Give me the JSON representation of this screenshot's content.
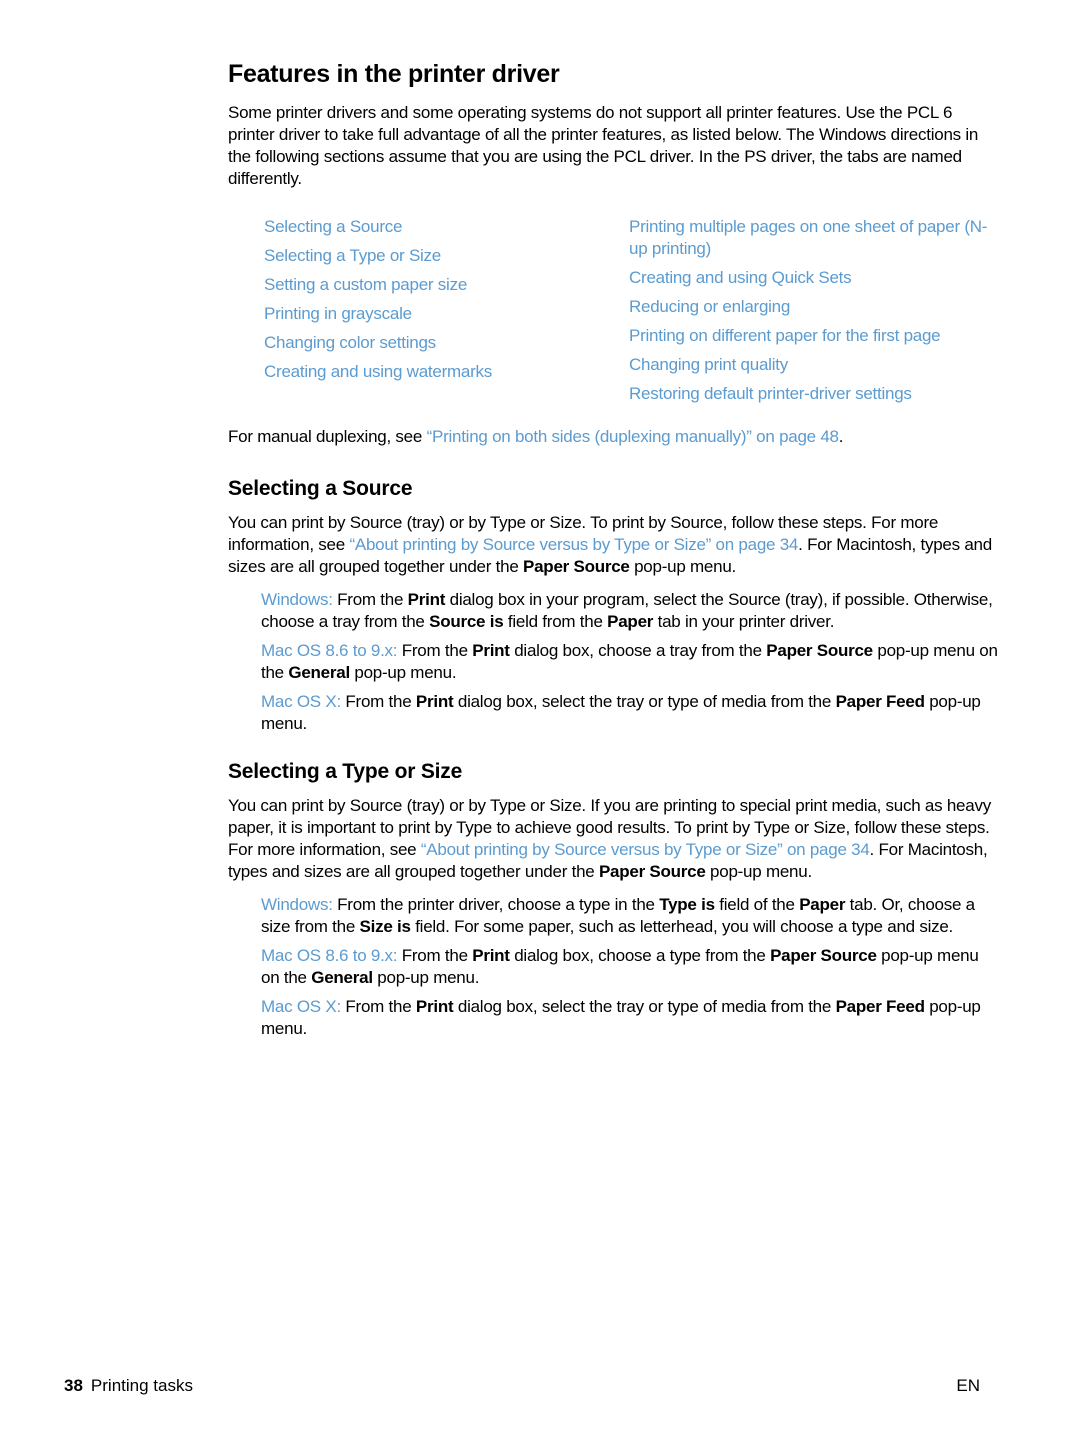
{
  "title": "Features in the printer driver",
  "intro": "Some printer drivers and some operating systems do not support all printer features. Use the PCL 6 printer driver to take full advantage of all the printer features, as listed below. The Windows directions in the following sections assume that you are using the PCL driver. In the PS driver, the tabs are named differently.",
  "toc": {
    "left": [
      "Selecting a Source",
      "Selecting a Type or Size",
      "Setting a custom paper size",
      "Printing in grayscale",
      "Changing color settings",
      "Creating and using watermarks"
    ],
    "right": [
      "Printing multiple pages on one sheet of paper (N-up printing)",
      "Creating and using Quick Sets",
      "Reducing or enlarging",
      "Printing on different paper for the first page",
      "Changing print quality",
      "Restoring default printer-driver settings"
    ]
  },
  "duplex": {
    "prefix": "For manual duplexing, see ",
    "link": "“Printing on both sides (duplexing manually)” on page 48",
    "suffix": "."
  },
  "section_source": {
    "heading": "Selecting a Source",
    "body_1": "You can print by Source (tray) or by Type or Size. To print by Source, follow these steps. For more information, see ",
    "body_link": "“About printing by Source versus by Type or Size” on page 34",
    "body_2": ". For Macintosh, types and sizes are all grouped together under the ",
    "body_bold": "Paper Source",
    "body_3": " pop-up menu.",
    "steps": {
      "windows": {
        "os": "Windows:",
        "t1": " From the ",
        "b1": "Print",
        "t2": " dialog box in your program, select the Source (tray), if possible. Otherwise, choose a tray from the ",
        "b2": "Source is",
        "t3": " field from the ",
        "b3": "Paper",
        "t4": " tab in your printer driver."
      },
      "mac9": {
        "os": "Mac OS 8.6 to 9.x:",
        "t1": " From the ",
        "b1": "Print",
        "t2": " dialog box, choose a tray from the ",
        "b2": "Paper Source",
        "t3": " pop-up menu on the ",
        "b3": "General",
        "t4": " pop-up menu."
      },
      "macx": {
        "os": "Mac OS X:",
        "t1": " From the ",
        "b1": "Print",
        "t2": " dialog box, select the tray or type of media from the ",
        "b2": "Paper Feed",
        "t3": " pop-up menu."
      }
    }
  },
  "section_type": {
    "heading": "Selecting a Type or Size",
    "body_1": "You can print by Source (tray) or by Type or Size. If you are printing to special print media, such as heavy paper, it is important to print by Type to achieve good results. To print by Type or Size, follow these steps. For more information, see ",
    "body_link": "“About printing by Source versus by Type or Size” on page 34",
    "body_2": ". For Macintosh, types and sizes are all grouped together under the ",
    "body_bold": "Paper Source",
    "body_3": " pop-up menu.",
    "steps": {
      "windows": {
        "os": "Windows:",
        "t1": " From the printer driver, choose a type in the ",
        "b1": "Type is",
        "t2": " field of the ",
        "b2": "Paper",
        "t3": " tab. Or, choose a size from the ",
        "b3": "Size is",
        "t4": " field. For some paper, such as letterhead, you will choose a type and size."
      },
      "mac9": {
        "os": "Mac OS 8.6 to 9.x:",
        "t1": " From the ",
        "b1": "Print",
        "t2": " dialog box, choose a type from the ",
        "b2": "Paper Source",
        "t3": " pop-up menu on the ",
        "b3": "General",
        "t4": " pop-up menu."
      },
      "macx": {
        "os": "Mac OS X:",
        "t1": " From the ",
        "b1": "Print",
        "t2": " dialog box, select the tray or type of media from the ",
        "b2": "Paper Feed",
        "t3": " pop-up menu."
      }
    }
  },
  "footer": {
    "page_number": "38",
    "chapter": "Printing tasks",
    "lang": "EN"
  },
  "colors": {
    "link": "#5b9bd0",
    "text": "#000000"
  }
}
